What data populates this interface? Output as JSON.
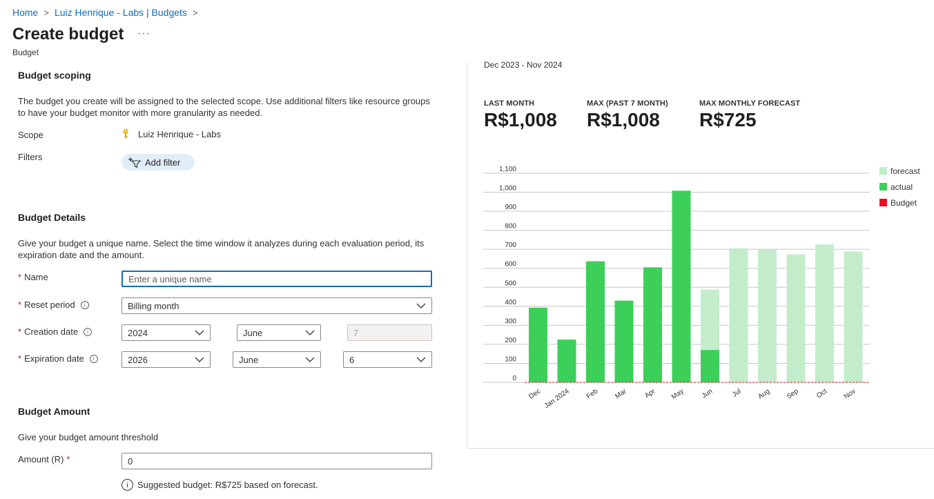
{
  "breadcrumb": {
    "home": "Home",
    "scope": "Luiz Henrique - Labs | Budgets",
    "sep": ">"
  },
  "header": {
    "title": "Create budget",
    "more": "···",
    "subtitle": "Budget"
  },
  "scoping": {
    "title": "Budget scoping",
    "desc": "The budget you create will be assigned to the selected scope. Use additional filters like resource groups to have your budget monitor with more granularity as needed.",
    "scope_label": "Scope",
    "scope_value": "Luiz Henrique - Labs",
    "filters_label": "Filters",
    "add_filter": "Add filter"
  },
  "details": {
    "title": "Budget Details",
    "desc": "Give your budget a unique name. Select the time window it analyzes during each evaluation period, its expiration date and the amount.",
    "name_label": "Name",
    "name_placeholder": "Enter a unique name",
    "reset_label": "Reset period",
    "reset_value": "Billing month",
    "creation_label": "Creation date",
    "creation_year": "2024",
    "creation_month": "June",
    "creation_day": "7",
    "expiration_label": "Expiration date",
    "expiration_year": "2026",
    "expiration_month": "June",
    "expiration_day": "6",
    "required_mark": "*",
    "info_glyph": "i"
  },
  "amount": {
    "title": "Budget Amount",
    "desc": "Give your budget amount threshold",
    "label": "Amount (R)",
    "value": "0",
    "suggestion": "Suggested budget: R$725 based on forecast."
  },
  "summary": {
    "period": "Dec 2023 - Nov 2024",
    "kpis": [
      {
        "label": "LAST MONTH",
        "value": "R$1,008"
      },
      {
        "label": "MAX (PAST 7 MONTH)",
        "value": "R$1,008"
      },
      {
        "label": "MAX MONTHLY FORECAST",
        "value": "R$725"
      }
    ]
  },
  "colors": {
    "actual": "#3ccf5a",
    "forecast": "#c3eccb",
    "budget": "#e81123",
    "link": "#0f6cbd"
  },
  "chart_data": {
    "type": "bar",
    "categories": [
      "Dec",
      "Jan 2024",
      "Feb",
      "Mar",
      "Apr",
      "May",
      "Jun",
      "Jul",
      "Aug",
      "Sep",
      "Oct",
      "Nov"
    ],
    "series": [
      {
        "name": "actual",
        "values": [
          393,
          225,
          637,
          430,
          605,
          1008,
          170,
          null,
          null,
          null,
          null,
          null
        ]
      },
      {
        "name": "forecast",
        "values": [
          null,
          null,
          null,
          null,
          null,
          null,
          488,
          705,
          698,
          672,
          725,
          688
        ]
      },
      {
        "name": "Budget",
        "values": [
          0,
          0,
          0,
          0,
          0,
          0,
          0,
          0,
          0,
          0,
          0,
          0
        ]
      }
    ],
    "yticks": [
      0,
      100,
      200,
      300,
      400,
      500,
      600,
      700,
      800,
      900,
      1000,
      1100
    ],
    "ytick_labels": [
      "0",
      "100",
      "200",
      "300",
      "400",
      "500",
      "600",
      "700",
      "800",
      "900",
      "1,000",
      "1,100"
    ],
    "ylim": [
      0,
      1150
    ],
    "grid": true,
    "legend": "right"
  }
}
